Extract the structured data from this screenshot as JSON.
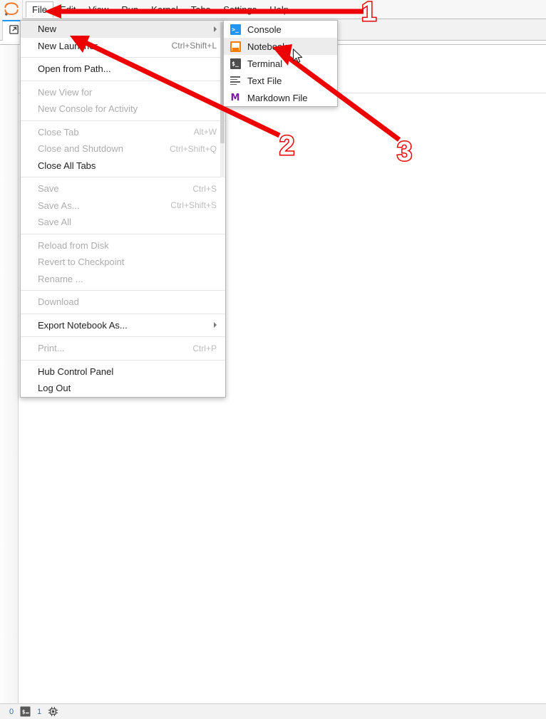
{
  "app": {
    "logo_icon": "jupyter-logo-icon",
    "launcher_tab_icon": "launcher-icon"
  },
  "menubar": {
    "items": [
      {
        "label": "File",
        "active": true
      },
      {
        "label": "Edit",
        "active": false
      },
      {
        "label": "View",
        "active": false
      },
      {
        "label": "Run",
        "active": false
      },
      {
        "label": "Kernel",
        "active": false
      },
      {
        "label": "Tabs",
        "active": false
      },
      {
        "label": "Settings",
        "active": false
      },
      {
        "label": "Help",
        "active": false
      }
    ]
  },
  "file_menu": {
    "rows": [
      {
        "label": "New",
        "shortcut": "",
        "disabled": false,
        "highlight": true,
        "submenu": true,
        "sep_after": false
      },
      {
        "label": "New Launcher",
        "shortcut": "Ctrl+Shift+L",
        "disabled": false,
        "highlight": false,
        "submenu": false,
        "sep_after": true
      },
      {
        "label": "Open from Path...",
        "shortcut": "",
        "disabled": false,
        "highlight": false,
        "submenu": false,
        "sep_after": true
      },
      {
        "label": "New View for",
        "shortcut": "",
        "disabled": true,
        "highlight": false,
        "submenu": false,
        "sep_after": false
      },
      {
        "label": "New Console for Activity",
        "shortcut": "",
        "disabled": true,
        "highlight": false,
        "submenu": false,
        "sep_after": true
      },
      {
        "label": "Close Tab",
        "shortcut": "Alt+W",
        "disabled": true,
        "highlight": false,
        "submenu": false,
        "sep_after": false
      },
      {
        "label": "Close and Shutdown",
        "shortcut": "Ctrl+Shift+Q",
        "disabled": true,
        "highlight": false,
        "submenu": false,
        "sep_after": false
      },
      {
        "label": "Close All Tabs",
        "shortcut": "",
        "disabled": false,
        "highlight": false,
        "submenu": false,
        "sep_after": true
      },
      {
        "label": "Save",
        "shortcut": "Ctrl+S",
        "disabled": true,
        "highlight": false,
        "submenu": false,
        "sep_after": false
      },
      {
        "label": "Save As...",
        "shortcut": "Ctrl+Shift+S",
        "disabled": true,
        "highlight": false,
        "submenu": false,
        "sep_after": false
      },
      {
        "label": "Save All",
        "shortcut": "",
        "disabled": true,
        "highlight": false,
        "submenu": false,
        "sep_after": true
      },
      {
        "label": "Reload from Disk",
        "shortcut": "",
        "disabled": true,
        "highlight": false,
        "submenu": false,
        "sep_after": false
      },
      {
        "label": "Revert to Checkpoint",
        "shortcut": "",
        "disabled": true,
        "highlight": false,
        "submenu": false,
        "sep_after": false
      },
      {
        "label": "Rename ...",
        "shortcut": "",
        "disabled": true,
        "highlight": false,
        "submenu": false,
        "sep_after": true
      },
      {
        "label": "Download",
        "shortcut": "",
        "disabled": true,
        "highlight": false,
        "submenu": false,
        "sep_after": true
      },
      {
        "label": "Export Notebook As...",
        "shortcut": "",
        "disabled": false,
        "highlight": false,
        "submenu": true,
        "sep_after": true
      },
      {
        "label": "Print...",
        "shortcut": "Ctrl+P",
        "disabled": true,
        "highlight": false,
        "submenu": false,
        "sep_after": true
      },
      {
        "label": "Hub Control Panel",
        "shortcut": "",
        "disabled": false,
        "highlight": false,
        "submenu": false,
        "sep_after": false
      },
      {
        "label": "Log Out",
        "shortcut": "",
        "disabled": false,
        "highlight": false,
        "submenu": false,
        "sep_after": false
      }
    ]
  },
  "new_submenu": {
    "rows": [
      {
        "label": "Console",
        "icon": "console-icon",
        "highlight": false
      },
      {
        "label": "Notebook",
        "icon": "notebook-icon",
        "highlight": true
      },
      {
        "label": "Terminal",
        "icon": "terminal-icon",
        "highlight": false
      },
      {
        "label": "Text File",
        "icon": "text-file-icon",
        "highlight": false
      },
      {
        "label": "Markdown File",
        "icon": "markdown-file-icon",
        "highlight": false
      }
    ]
  },
  "statusbar": {
    "terminals_count": "0",
    "terminal_icon": "terminal-icon",
    "kernels_count": "1",
    "kernel_icon": "kernel-chip-icon"
  },
  "annotations": {
    "color": "#ee0000",
    "steps": [
      {
        "number": "1",
        "target": "File menu"
      },
      {
        "number": "2",
        "target": "New"
      },
      {
        "number": "3",
        "target": "Notebook"
      }
    ]
  }
}
